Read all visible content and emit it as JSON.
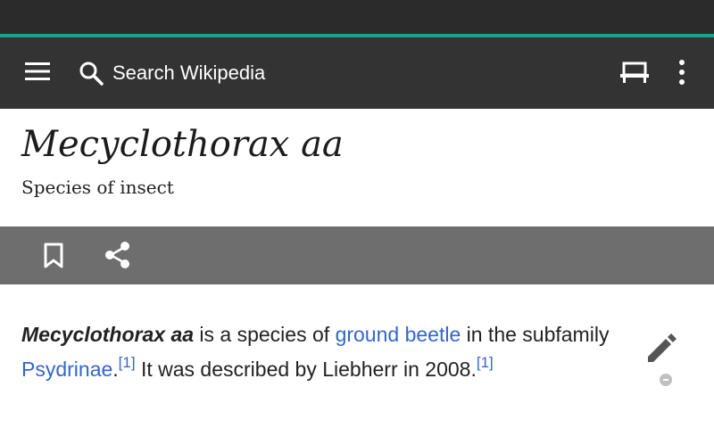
{
  "toolbar": {
    "search_placeholder": "Search Wikipedia",
    "icons": [
      "menu-icon",
      "search-icon",
      "reading-list-icon",
      "more-options-icon"
    ]
  },
  "article": {
    "title": "Mecyclothorax aa",
    "description": "Species of insect",
    "actions": [
      "bookmark-icon",
      "share-icon"
    ],
    "body": {
      "term": "Mecyclothorax aa",
      "text1": " is a species of ",
      "link1": "ground beetle",
      "text2": " in the subfamily ",
      "link2": "Psydrinae",
      "text3": ".",
      "ref1": "[1]",
      "text4": " It was described by Liebherr in 2008.",
      "ref2": "[1]"
    }
  },
  "colors": {
    "statusbar": "#2b2b2b",
    "accent": "#1f9f8d",
    "toolbar": "#333333",
    "actionbar": "#6e6e6e",
    "link": "#3366cc"
  }
}
